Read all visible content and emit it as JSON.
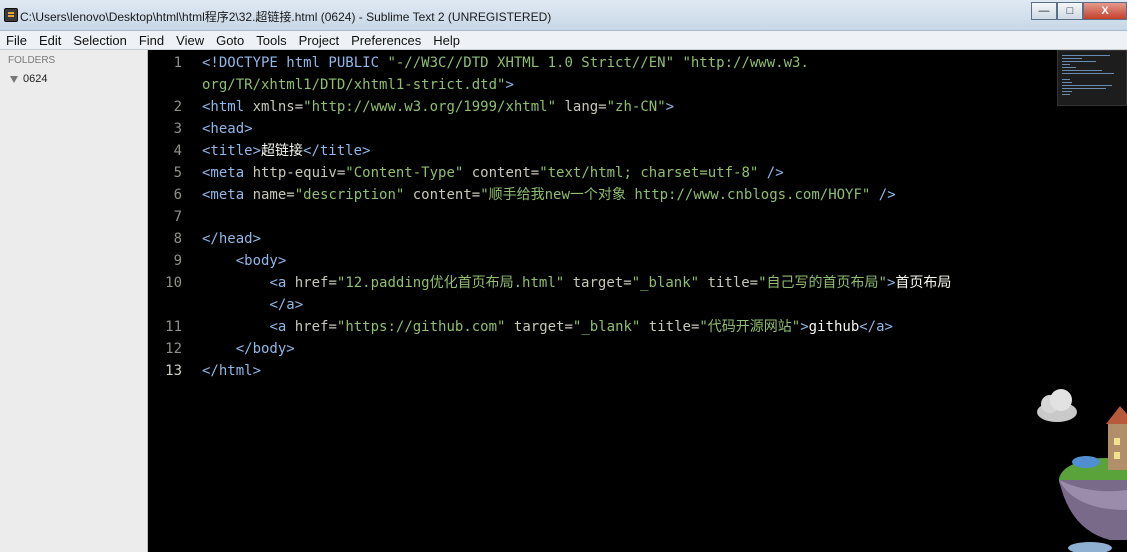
{
  "window": {
    "title": "C:\\Users\\lenovo\\Desktop\\html\\html程序2\\32.超链接.html (0624) - Sublime Text 2 (UNREGISTERED)",
    "controls": [
      "—",
      "□",
      "X"
    ]
  },
  "menu": [
    "File",
    "Edit",
    "Selection",
    "Find",
    "View",
    "Goto",
    "Tools",
    "Project",
    "Preferences",
    "Help"
  ],
  "sidebar": {
    "heading": "FOLDERS",
    "folder": "0624"
  },
  "editor": {
    "active_line": "13",
    "lines": [
      {
        "n": "1",
        "segs": [
          [
            "t",
            "<!DOCTYPE html PUBLIC "
          ],
          [
            "s",
            "\"-//W3C//DTD XHTML 1.0 Strict//EN\""
          ],
          [
            "p",
            " "
          ],
          [
            "s",
            "\"http://www.w3."
          ]
        ]
      },
      {
        "n": "",
        "segs": [
          [
            "s",
            "org/TR/xhtml1/DTD/xhtml1-strict.dtd\""
          ],
          [
            "t",
            ">"
          ]
        ]
      },
      {
        "n": "2",
        "segs": [
          [
            "t",
            "<html "
          ],
          [
            "a",
            "xmlns="
          ],
          [
            "s",
            "\"http://www.w3.org/1999/xhtml\""
          ],
          [
            "p",
            " "
          ],
          [
            "a",
            "lang="
          ],
          [
            "s",
            "\"zh-CN\""
          ],
          [
            "t",
            ">"
          ]
        ]
      },
      {
        "n": "3",
        "segs": [
          [
            "t",
            "<head>"
          ]
        ]
      },
      {
        "n": "4",
        "segs": [
          [
            "t",
            "<title>"
          ],
          [
            "p",
            "超链接"
          ],
          [
            "t",
            "</title>"
          ]
        ]
      },
      {
        "n": "5",
        "segs": [
          [
            "t",
            "<meta "
          ],
          [
            "a",
            "http-equiv="
          ],
          [
            "s",
            "\"Content-Type\""
          ],
          [
            "p",
            " "
          ],
          [
            "a",
            "content="
          ],
          [
            "s",
            "\"text/html; charset=utf-8\""
          ],
          [
            "t",
            " />"
          ]
        ]
      },
      {
        "n": "6",
        "segs": [
          [
            "t",
            "<meta "
          ],
          [
            "a",
            "name="
          ],
          [
            "s",
            "\"description\""
          ],
          [
            "p",
            " "
          ],
          [
            "a",
            "content="
          ],
          [
            "s",
            "\"顺手给我new一个对象 http://www.cnblogs.com/HOYF\""
          ],
          [
            "t",
            " />"
          ]
        ]
      },
      {
        "n": "7",
        "segs": []
      },
      {
        "n": "8",
        "segs": [
          [
            "t",
            "</head>"
          ]
        ]
      },
      {
        "n": "9",
        "segs": [
          [
            "p",
            "    "
          ],
          [
            "t",
            "<body>"
          ]
        ]
      },
      {
        "n": "10",
        "segs": [
          [
            "p",
            "        "
          ],
          [
            "t",
            "<a "
          ],
          [
            "a",
            "href="
          ],
          [
            "s",
            "\"12.padding优化首页布局.html\""
          ],
          [
            "p",
            " "
          ],
          [
            "a",
            "target="
          ],
          [
            "s",
            "\"_blank\""
          ],
          [
            "p",
            " "
          ],
          [
            "a",
            "title="
          ],
          [
            "s",
            "\"自己写的首页布局\""
          ],
          [
            "t",
            ">"
          ],
          [
            "p",
            "首页布局"
          ]
        ]
      },
      {
        "n": "",
        "segs": [
          [
            "p",
            "        "
          ],
          [
            "t",
            "</a>"
          ]
        ]
      },
      {
        "n": "11",
        "segs": [
          [
            "p",
            "        "
          ],
          [
            "t",
            "<a "
          ],
          [
            "a",
            "href="
          ],
          [
            "s",
            "\"https://github.com\""
          ],
          [
            "p",
            " "
          ],
          [
            "a",
            "target="
          ],
          [
            "s",
            "\"_blank\""
          ],
          [
            "p",
            " "
          ],
          [
            "a",
            "title="
          ],
          [
            "s",
            "\"代码开源网站\""
          ],
          [
            "t",
            ">"
          ],
          [
            "p",
            "github"
          ],
          [
            "t",
            "</a>"
          ]
        ]
      },
      {
        "n": "12",
        "segs": [
          [
            "p",
            "    "
          ],
          [
            "t",
            "</body>"
          ]
        ]
      },
      {
        "n": "13",
        "segs": [
          [
            "t",
            "</html>"
          ]
        ]
      }
    ]
  }
}
